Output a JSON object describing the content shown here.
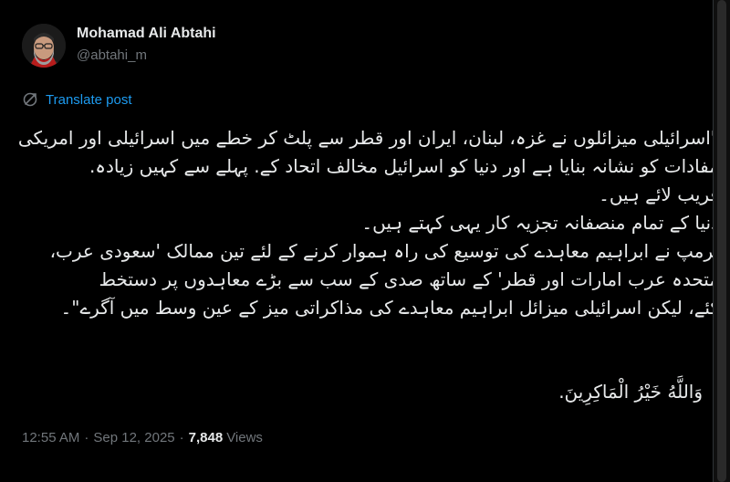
{
  "author": {
    "name": "Mohamad Ali Abtahi",
    "handle": "@abtahi_m",
    "avatar_icon": "avatar-photo"
  },
  "translate": {
    "icon": "translate-icon",
    "label": "Translate post"
  },
  "post": {
    "lines": [
      "\"اسرائیلی میزائلوں نے غزہ، لبنان، ایران اور قطر سے پلٹ کر خطے میں اسرائیلی اور امریکی",
      "مفادات کو نشانہ بنایا ہے اور دنیا کو اسرائیل مخالف اتحاد کے. پہلے سے کہیں زیادہ.",
      "قریب لائے ہیں۔",
      "دنیا کے تمام منصفانہ تجزیہ کار یہی کہتے ہیں۔",
      "ٹرمپ نے ابراہیم معاہدے کی توسیع کی راہ ہموار کرنے کے لئے تین ممالک 'سعودی عرب،",
      "متحدہ عرب امارات اور قطر' کے ساتھ صدی کے سب سے بڑے معاہدوں پر دستخط",
      "کئے، لیکن اسرائیلی میزائل ابراہیم معاہدے کی مذاکراتی میز کے عین وسط میں آگرے\"۔"
    ],
    "closing": "وَاللَّهُ خَيْرُ الْمَاكِرِينَ."
  },
  "meta": {
    "time": "12:55 AM",
    "separator": "·",
    "date": "Sep 12, 2025",
    "views_count": "7,848",
    "views_label": "Views"
  },
  "colors": {
    "background": "#000000",
    "text": "#e7e9ea",
    "muted": "#71767b",
    "link": "#1d9bf0"
  }
}
